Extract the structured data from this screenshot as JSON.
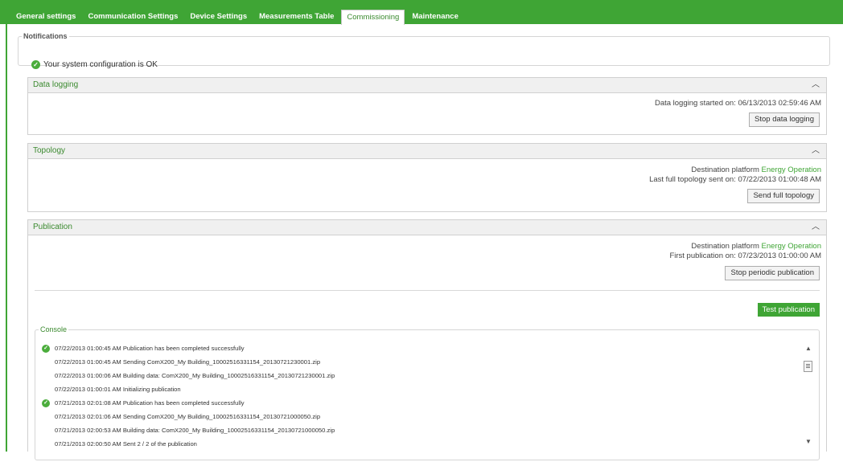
{
  "tabs": [
    {
      "label": "General settings",
      "active": false
    },
    {
      "label": "Communication Settings",
      "active": false
    },
    {
      "label": "Device Settings",
      "active": false
    },
    {
      "label": "Measurements Table",
      "active": false
    },
    {
      "label": "Commissioning",
      "active": true
    },
    {
      "label": "Maintenance",
      "active": false
    }
  ],
  "notifications": {
    "legend": "Notifications",
    "message": "Your system configuration is OK",
    "icon": "check-circle-icon"
  },
  "data_logging": {
    "title": "Data logging",
    "started_label": "Data logging started on:",
    "started_value": "06/13/2013 02:59:46 AM",
    "button": "Stop data logging"
  },
  "topology": {
    "title": "Topology",
    "dest_label": "Destination platform",
    "dest_value": "Energy Operation",
    "last_label": "Last full topology sent on:",
    "last_value": "07/22/2013 01:00:48 AM",
    "button": "Send full topology"
  },
  "publication": {
    "title": "Publication",
    "dest_label": "Destination platform",
    "dest_value": "Energy Operation",
    "first_label": "First publication on:",
    "first_value": "07/23/2013 01:00:00 AM",
    "stop_button": "Stop periodic publication",
    "test_button": "Test publication"
  },
  "console": {
    "legend": "Console",
    "lines": [
      {
        "text": "07/22/2013 01:00:45 AM Publication has been completed successfully",
        "ok": true
      },
      {
        "text": "07/22/2013 01:00:45 AM Sending ComX200_My Building_10002516331154_20130721230001.zip",
        "ok": false
      },
      {
        "text": "07/22/2013 01:00:06 AM Building data: ComX200_My Building_10002516331154_20130721230001.zip",
        "ok": false
      },
      {
        "text": "07/22/2013 01:00:01 AM Initializing publication",
        "ok": false
      },
      {
        "text": "07/21/2013 02:01:08 AM Publication has been completed successfully",
        "ok": true
      },
      {
        "text": "07/21/2013 02:01:06 AM Sending ComX200_My Building_10002516331154_20130721000050.zip",
        "ok": false
      },
      {
        "text": "07/21/2013 02:00:53 AM Building data: ComX200_My Building_10002516331154_20130721000050.zip",
        "ok": false
      },
      {
        "text": "07/21/2013 02:00:50 AM Sent 2 / 2 of the publication",
        "ok": false
      }
    ]
  },
  "colors": {
    "brand_green": "#3fa535",
    "label_green": "#3b8a2f"
  }
}
